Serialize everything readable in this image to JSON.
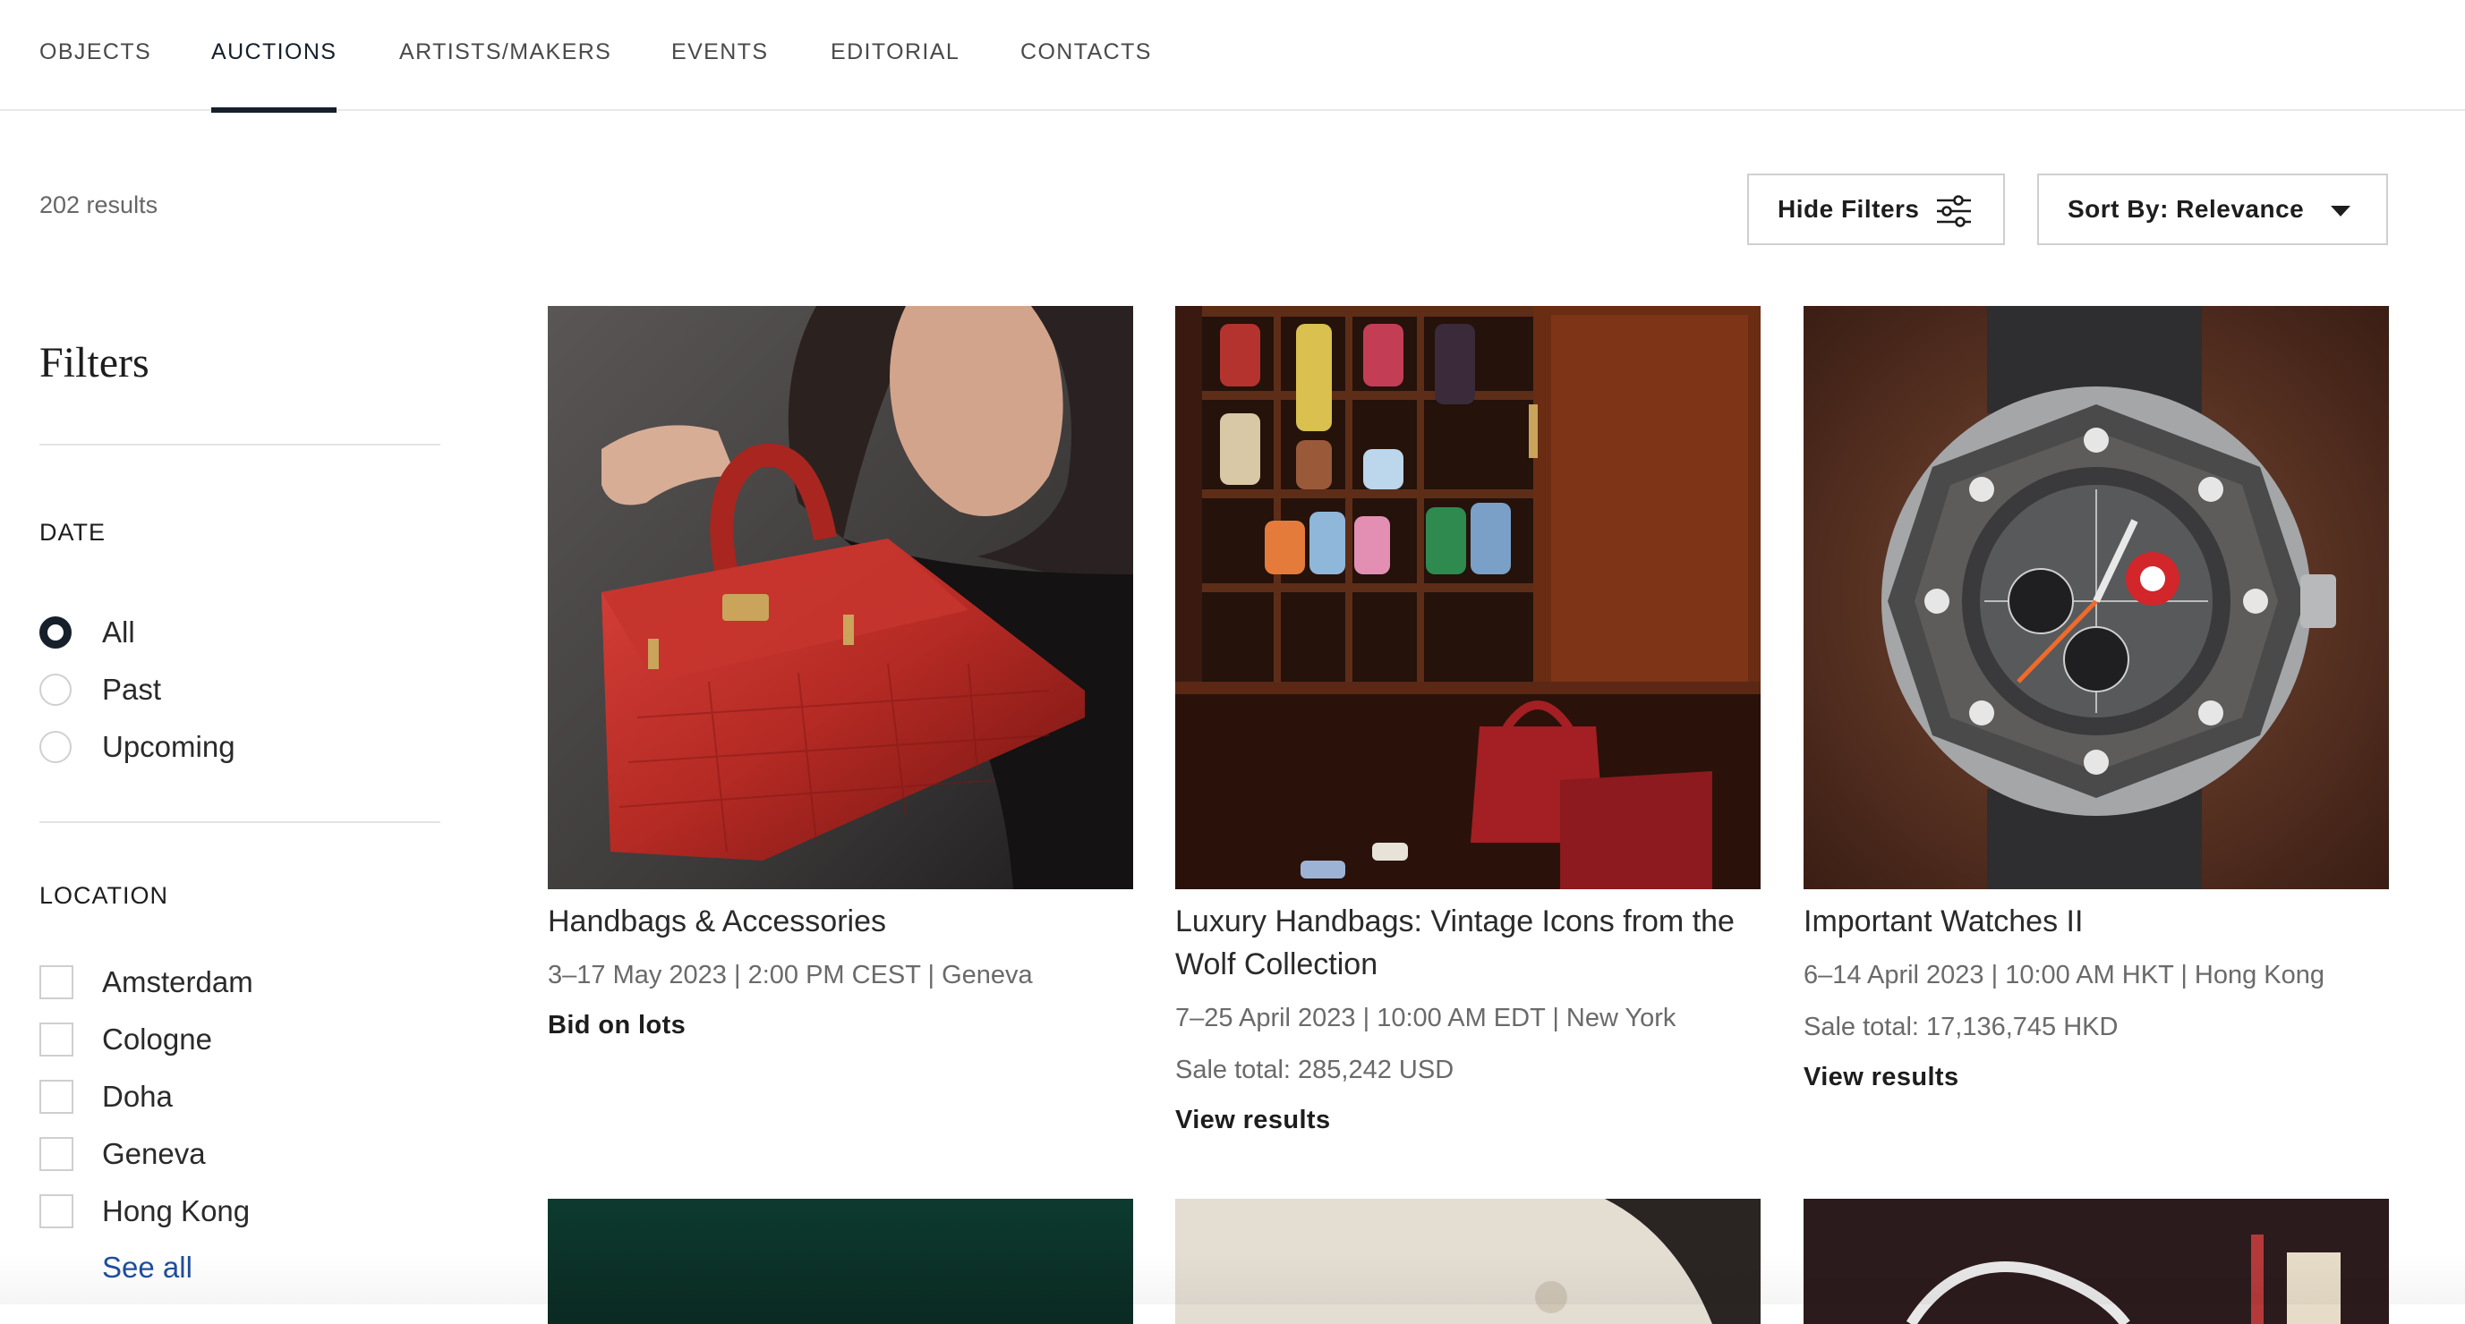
{
  "nav": {
    "tabs": [
      {
        "label": "OBJECTS"
      },
      {
        "label": "AUCTIONS"
      },
      {
        "label": "ARTISTS/MAKERS"
      },
      {
        "label": "EVENTS"
      },
      {
        "label": "EDITORIAL"
      },
      {
        "label": "CONTACTS"
      }
    ],
    "active": "AUCTIONS"
  },
  "results": {
    "count_text": "202 results"
  },
  "controls": {
    "hide_filters_label": "Hide Filters",
    "sort_label": "Sort By: Relevance"
  },
  "filters": {
    "title": "Filters",
    "date": {
      "heading": "DATE",
      "options": [
        {
          "label": "All",
          "selected": true
        },
        {
          "label": "Past",
          "selected": false
        },
        {
          "label": "Upcoming",
          "selected": false
        }
      ]
    },
    "location": {
      "heading": "LOCATION",
      "options": [
        {
          "label": "Amsterdam",
          "checked": false
        },
        {
          "label": "Cologne",
          "checked": false
        },
        {
          "label": "Doha",
          "checked": false
        },
        {
          "label": "Geneva",
          "checked": false
        },
        {
          "label": "Hong Kong",
          "checked": false
        }
      ],
      "see_all_label": "See all"
    }
  },
  "auctions": [
    {
      "title": "Handbags & Accessories",
      "date_location": "3–17 May 2023 | 2:00 PM CEST | Geneva",
      "sale_total": "",
      "action": "Bid on lots",
      "image": "red-crocodile-handbag-photo"
    },
    {
      "title": "Luxury Handbags: Vintage Icons from the Wolf Collection",
      "date_location": "7–25 April 2023 | 10:00 AM EDT | New York",
      "sale_total": "Sale total: 285,242 USD",
      "action": "View results",
      "image": "handbags-in-cabinet-photo"
    },
    {
      "title": "Important Watches II",
      "date_location": "6–14 April 2023 | 10:00 AM HKT | Hong Kong",
      "sale_total": "Sale total: 17,136,745 HKD",
      "action": "View results",
      "image": "chronograph-watch-photo"
    }
  ],
  "colors": {
    "accent": "#15202b",
    "link": "#1f4e9c",
    "muted_text": "#6a6a6a",
    "border": "#cfcfcf"
  }
}
